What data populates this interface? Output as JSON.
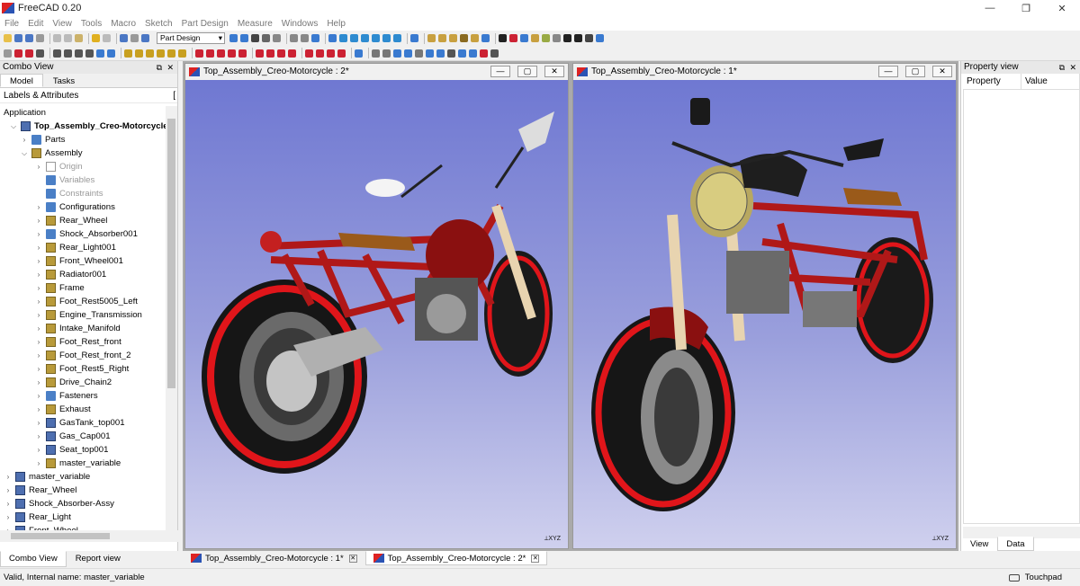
{
  "window": {
    "title": "FreeCAD 0.20"
  },
  "menu": [
    "File",
    "Edit",
    "View",
    "Tools",
    "Macro",
    "Sketch",
    "Part Design",
    "Measure",
    "Windows",
    "Help"
  ],
  "toolbar": {
    "workbench": "Part Design"
  },
  "combo_view": {
    "title": "Combo View",
    "tabs": [
      "Model",
      "Tasks"
    ],
    "tree_header": "Labels & Attributes",
    "tree": [
      {
        "label": "Application",
        "depth": 0,
        "icon": "none",
        "arrow": ""
      },
      {
        "label": "Top_Assembly_Creo-Motorcycle",
        "depth": 1,
        "icon": "document-icon",
        "arrow": "v",
        "bold": true
      },
      {
        "label": "Parts",
        "depth": 2,
        "icon": "folder-icon",
        "arrow": ">"
      },
      {
        "label": "Assembly",
        "depth": 2,
        "icon": "part-icon",
        "arrow": "v"
      },
      {
        "label": "Origin",
        "depth": 3,
        "icon": "origin-icon",
        "arrow": ">",
        "muted": true
      },
      {
        "label": "Variables",
        "depth": 3,
        "icon": "folder-icon",
        "arrow": "",
        "muted": true
      },
      {
        "label": "Constraints",
        "depth": 3,
        "icon": "folder-icon",
        "arrow": "",
        "muted": true
      },
      {
        "label": "Configurations",
        "depth": 3,
        "icon": "folder-icon",
        "arrow": ">"
      },
      {
        "label": "Rear_Wheel",
        "depth": 3,
        "icon": "part-icon",
        "arrow": ">"
      },
      {
        "label": "Shock_Absorber001",
        "depth": 3,
        "icon": "folder-icon",
        "arrow": ">"
      },
      {
        "label": "Rear_Light001",
        "depth": 3,
        "icon": "part-icon",
        "arrow": ">"
      },
      {
        "label": "Front_Wheel001",
        "depth": 3,
        "icon": "part-icon",
        "arrow": ">"
      },
      {
        "label": "Radiator001",
        "depth": 3,
        "icon": "part-icon",
        "arrow": ">"
      },
      {
        "label": "Frame",
        "depth": 3,
        "icon": "part-icon",
        "arrow": ">"
      },
      {
        "label": "Foot_Rest5005_Left",
        "depth": 3,
        "icon": "part-icon",
        "arrow": ">"
      },
      {
        "label": "Engine_Transmission",
        "depth": 3,
        "icon": "part-icon",
        "arrow": ">"
      },
      {
        "label": "Intake_Manifold",
        "depth": 3,
        "icon": "part-icon",
        "arrow": ">"
      },
      {
        "label": "Foot_Rest_front",
        "depth": 3,
        "icon": "part-icon",
        "arrow": ">"
      },
      {
        "label": "Foot_Rest_front_2",
        "depth": 3,
        "icon": "part-icon",
        "arrow": ">"
      },
      {
        "label": "Foot_Rest5_Right",
        "depth": 3,
        "icon": "part-icon",
        "arrow": ">"
      },
      {
        "label": "Drive_Chain2",
        "depth": 3,
        "icon": "part-icon",
        "arrow": ">"
      },
      {
        "label": "Fasteners",
        "depth": 3,
        "icon": "folder-icon",
        "arrow": ">"
      },
      {
        "label": "Exhaust",
        "depth": 3,
        "icon": "part-icon",
        "arrow": ">"
      },
      {
        "label": "GasTank_top001",
        "depth": 3,
        "icon": "document-icon",
        "arrow": ">"
      },
      {
        "label": "Gas_Cap001",
        "depth": 3,
        "icon": "document-icon",
        "arrow": ">"
      },
      {
        "label": "Seat_top001",
        "depth": 3,
        "icon": "document-icon",
        "arrow": ">"
      },
      {
        "label": "master_variable",
        "depth": 3,
        "icon": "part-icon",
        "arrow": ">"
      },
      {
        "label": "master_variable",
        "depth": 0,
        "icon": "document-icon",
        "arrow": ">"
      },
      {
        "label": "Rear_Wheel",
        "depth": 0,
        "icon": "document-icon",
        "arrow": ">"
      },
      {
        "label": "Shock_Absorber-Assy",
        "depth": 0,
        "icon": "document-icon",
        "arrow": ">"
      },
      {
        "label": "Rear_Light",
        "depth": 0,
        "icon": "document-icon",
        "arrow": ">"
      },
      {
        "label": "Front_Wheel",
        "depth": 0,
        "icon": "document-icon",
        "arrow": ">"
      }
    ],
    "bottom_tabs": [
      "Combo View",
      "Report view"
    ]
  },
  "views": [
    {
      "title": "Top_Assembly_Creo-Motorcycle : 2*"
    },
    {
      "title": "Top_Assembly_Creo-Motorcycle : 1*"
    }
  ],
  "doc_tabs": [
    "Top_Assembly_Creo-Motorcycle : 1*",
    "Top_Assembly_Creo-Motorcycle : 2*"
  ],
  "property_view": {
    "title": "Property view",
    "columns": [
      "Property",
      "Value"
    ],
    "tabs": [
      "View",
      "Data"
    ]
  },
  "status": {
    "message": "Valid, Internal name: master_variable",
    "nav_style": "Touchpad"
  },
  "colors": {
    "viewport_top": "#6f78d2",
    "viewport_bottom": "#cfd0ee",
    "frame_red": "#b01818",
    "rim_red": "#e0151a"
  }
}
